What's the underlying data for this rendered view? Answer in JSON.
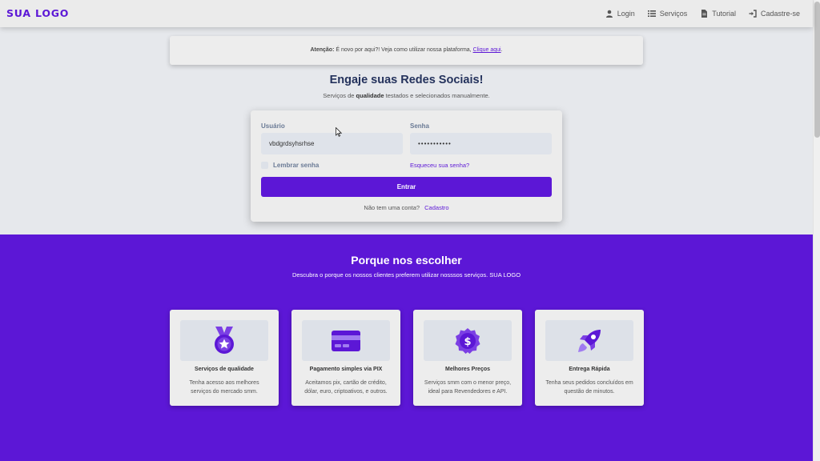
{
  "navbar": {
    "logo": "SUA LOGO",
    "links": [
      {
        "label": "Login",
        "icon": "user-icon"
      },
      {
        "label": "Serviços",
        "icon": "list-icon"
      },
      {
        "label": "Tutorial",
        "icon": "file-icon"
      },
      {
        "label": "Cadastre-se",
        "icon": "sign-in-icon"
      }
    ]
  },
  "alert": {
    "prefix": "Atenção:",
    "text": " É novo por aqui?! Veja como utilizar nossa plataforma, ",
    "link": "Clique aqui",
    "suffix": "."
  },
  "hero": {
    "title": "Engaje suas Redes Sociais!",
    "sub_before": "Serviços de ",
    "sub_bold": "qualidade",
    "sub_after": " testados e selecionados manualmente."
  },
  "login": {
    "username_label": "Usuário",
    "username_value": "vbdgrdsyhsrhse",
    "password_label": "Senha",
    "password_value": "•••••••••••",
    "remember_label": "Lembrar senha",
    "forgot_link": "Esqueceu sua senha?",
    "submit_label": "Entrar",
    "no_account": "Não tem uma conta?",
    "signup_link": "Cadastro"
  },
  "why": {
    "title": "Porque nos escolher",
    "subtitle": "Descubra o porque os nossos clientes preferem utilizar nosssos serviços.  SUA LOGO"
  },
  "features": [
    {
      "title": "Serviços de qualidade",
      "desc": "Tenha acesso aos melhores serviços do mercado smm.",
      "icon": "medal-icon"
    },
    {
      "title": "Pagamento simples via PIX",
      "desc": "Aceitamos pix, cartão de crédito, dólar, euro, criptoativos, e outros.",
      "icon": "credit-card-icon"
    },
    {
      "title": "Melhores Preços",
      "desc": "Serviços smm com o menor preço, ideal para Revendedores e API.",
      "icon": "dollar-badge-icon"
    },
    {
      "title": "Entrega Rápida",
      "desc": "Tenha seus pedidos concluídos em questão de minutos.",
      "icon": "rocket-icon"
    }
  ],
  "colors": {
    "accent": "#5c17d6",
    "page_bg": "#e6e8ec",
    "heading": "#24325c"
  }
}
